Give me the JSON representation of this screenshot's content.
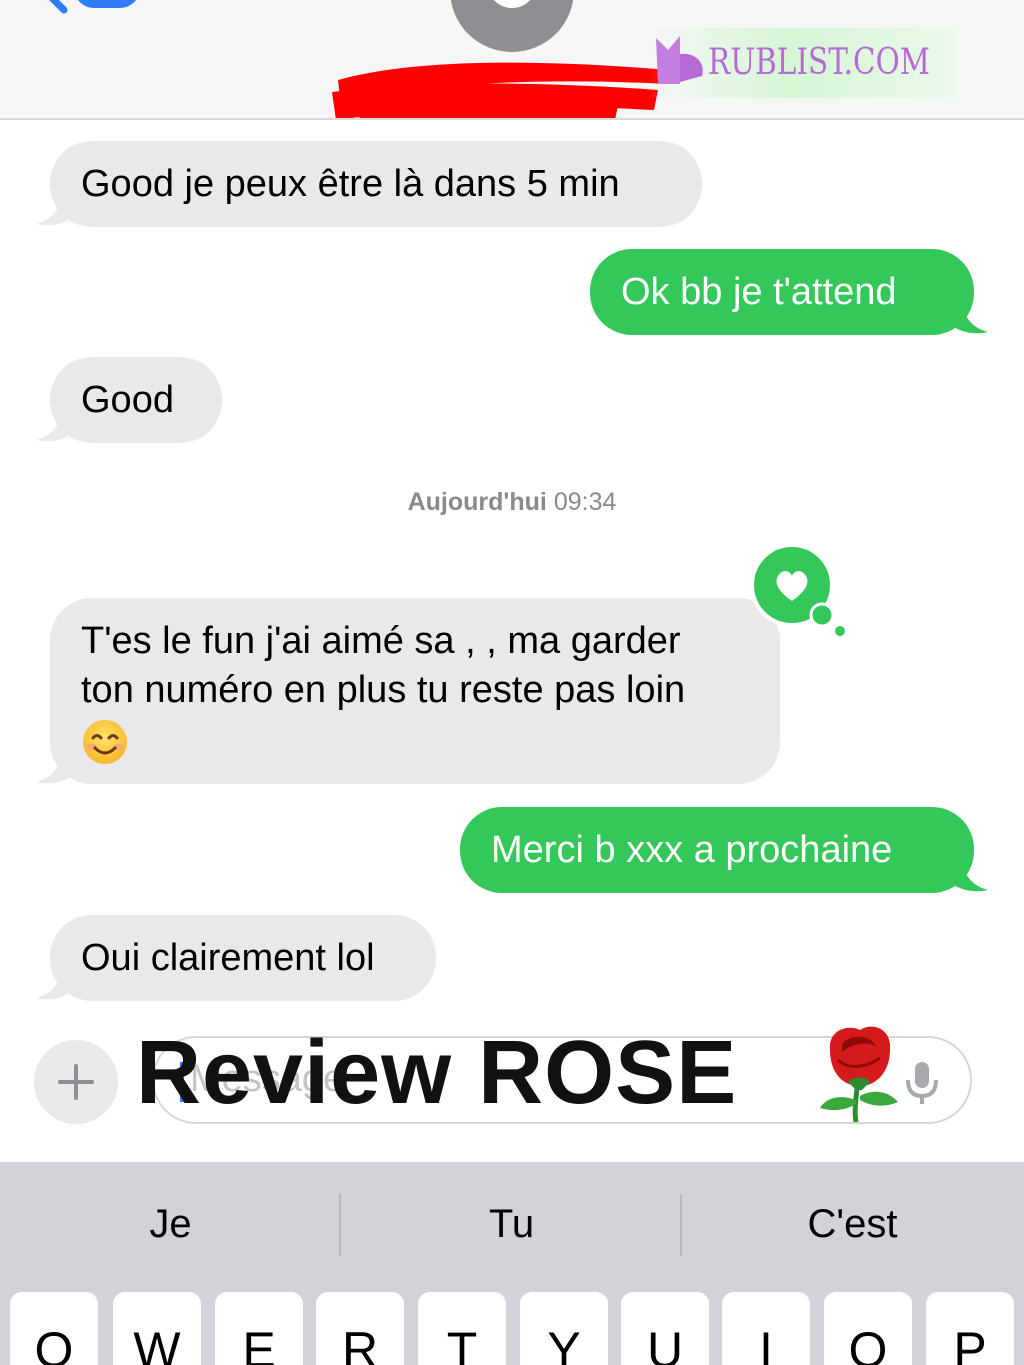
{
  "header": {
    "watermark_text": "RUBLIST.COM"
  },
  "messages": [
    {
      "id": "m1",
      "direction": "incoming",
      "text": "Good je peux être là dans 5 min"
    },
    {
      "id": "m2",
      "direction": "outgoing",
      "text": "Ok bb je t'attend"
    },
    {
      "id": "m3",
      "direction": "incoming",
      "text": "Good"
    },
    {
      "id": "m4",
      "direction": "incoming",
      "line1": "T'es le fun j'ai aimé sa , , ma garder",
      "line2": "ton numéro en plus tu reste pas loin",
      "emoji": "smiling-face-emoji",
      "reaction": "heart"
    },
    {
      "id": "m5",
      "direction": "outgoing",
      "text": "Merci b xxx a prochaine"
    },
    {
      "id": "m6",
      "direction": "incoming",
      "text": "Oui clairement lol"
    }
  ],
  "timestamp": {
    "day": "Aujourd'hui",
    "time": "09:34"
  },
  "input": {
    "placeholder": "Message"
  },
  "overlay": {
    "title": "Review ROSE",
    "emoji": "rose-emoji"
  },
  "keyboard": {
    "suggestions": [
      "Je",
      "Tu",
      "C'est"
    ],
    "top_row": [
      "Q",
      "W",
      "E",
      "R",
      "T",
      "Y",
      "U",
      "I",
      "O",
      "P"
    ]
  },
  "colors": {
    "incoming_bubble": "#e9e9eb",
    "outgoing_bubble": "#34c759",
    "accent_blue": "#2f7cf6",
    "keyboard_bg": "#d1d3d9",
    "watermark": "#b66ad6"
  }
}
